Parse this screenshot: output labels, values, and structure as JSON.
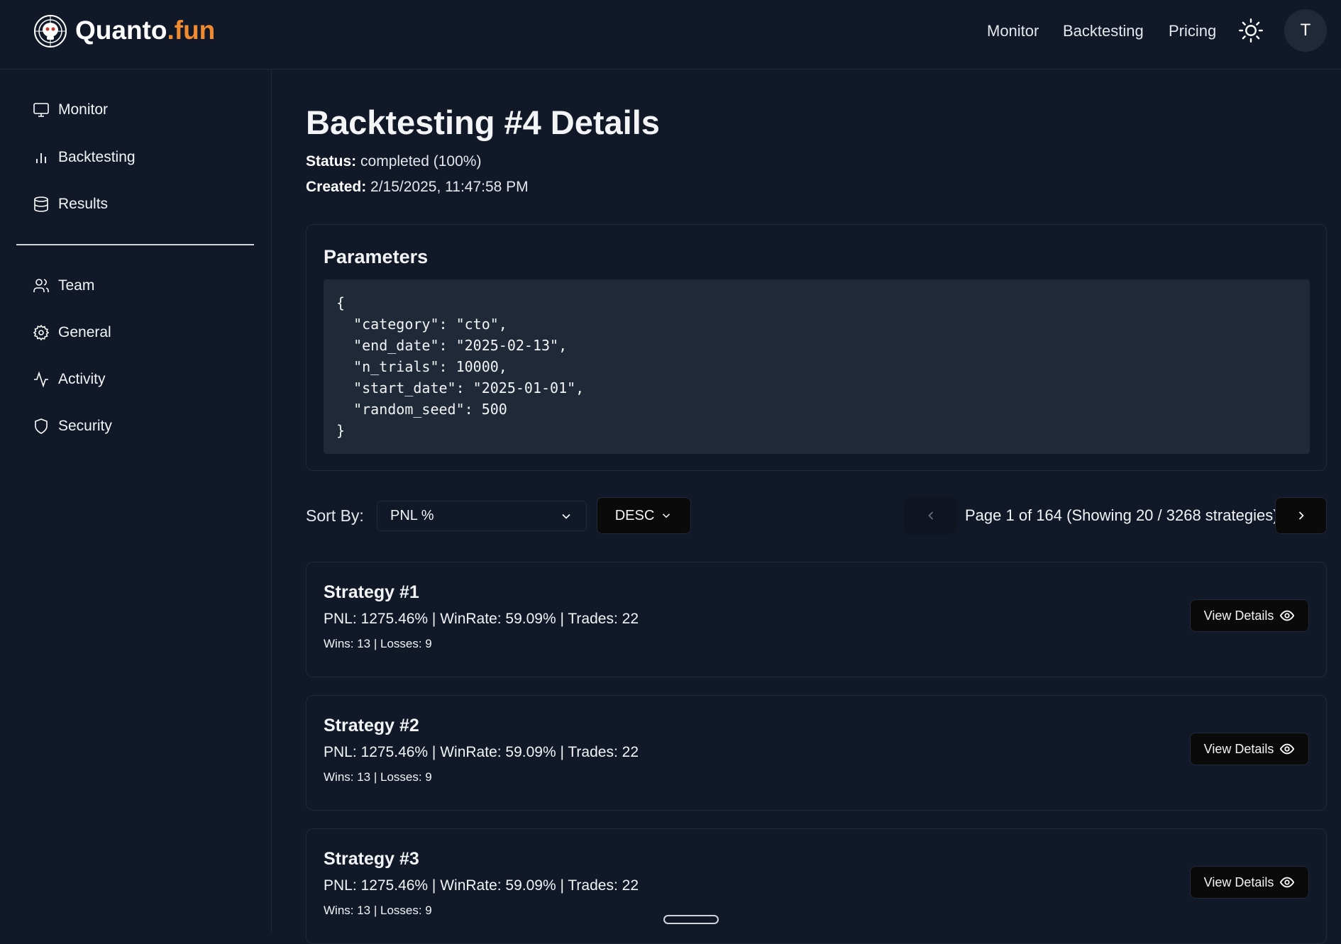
{
  "header": {
    "brand_main": "Quanto",
    "brand_accent": ".fun",
    "nav": [
      "Monitor",
      "Backtesting",
      "Pricing"
    ],
    "avatar_initial": "T",
    "accent_color": "#f08a31"
  },
  "sidebar": {
    "items": [
      {
        "label": "Monitor",
        "icon": "monitor-icon"
      },
      {
        "label": "Backtesting",
        "icon": "bar-chart-icon"
      },
      {
        "label": "Results",
        "icon": "database-icon"
      },
      {
        "label": "Team",
        "icon": "users-icon"
      },
      {
        "label": "General",
        "icon": "gear-icon"
      },
      {
        "label": "Activity",
        "icon": "activity-icon"
      },
      {
        "label": "Security",
        "icon": "shield-icon"
      }
    ]
  },
  "page": {
    "title": "Backtesting #4 Details",
    "status_label": "Status:",
    "status_value": "completed (100%)",
    "created_label": "Created:",
    "created_value": "2/15/2025, 11:47:58 PM"
  },
  "parameters": {
    "title": "Parameters",
    "code": "{\n  \"category\": \"cto\",\n  \"end_date\": \"2025-02-13\",\n  \"n_trials\": 10000,\n  \"start_date\": \"2025-01-01\",\n  \"random_seed\": 500\n}"
  },
  "sort": {
    "label": "Sort By:",
    "selected": "PNL %",
    "order": "DESC"
  },
  "pagination": {
    "text": "Page 1 of 164 (Showing 20 / 3268 strategies)",
    "current_page": 1,
    "total_pages": 164
  },
  "strategies": [
    {
      "title": "Strategy #1",
      "stats": "PNL: 1275.46% | WinRate: 59.09% | Trades: 22",
      "wl": "Wins: 13 | Losses: 9",
      "button": "View Details"
    },
    {
      "title": "Strategy #2",
      "stats": "PNL: 1275.46% | WinRate: 59.09% | Trades: 22",
      "wl": "Wins: 13 | Losses: 9",
      "button": "View Details"
    },
    {
      "title": "Strategy #3",
      "stats": "PNL: 1275.46% | WinRate: 59.09% | Trades: 22",
      "wl": "Wins: 13 | Losses: 9",
      "button": "View Details"
    }
  ]
}
